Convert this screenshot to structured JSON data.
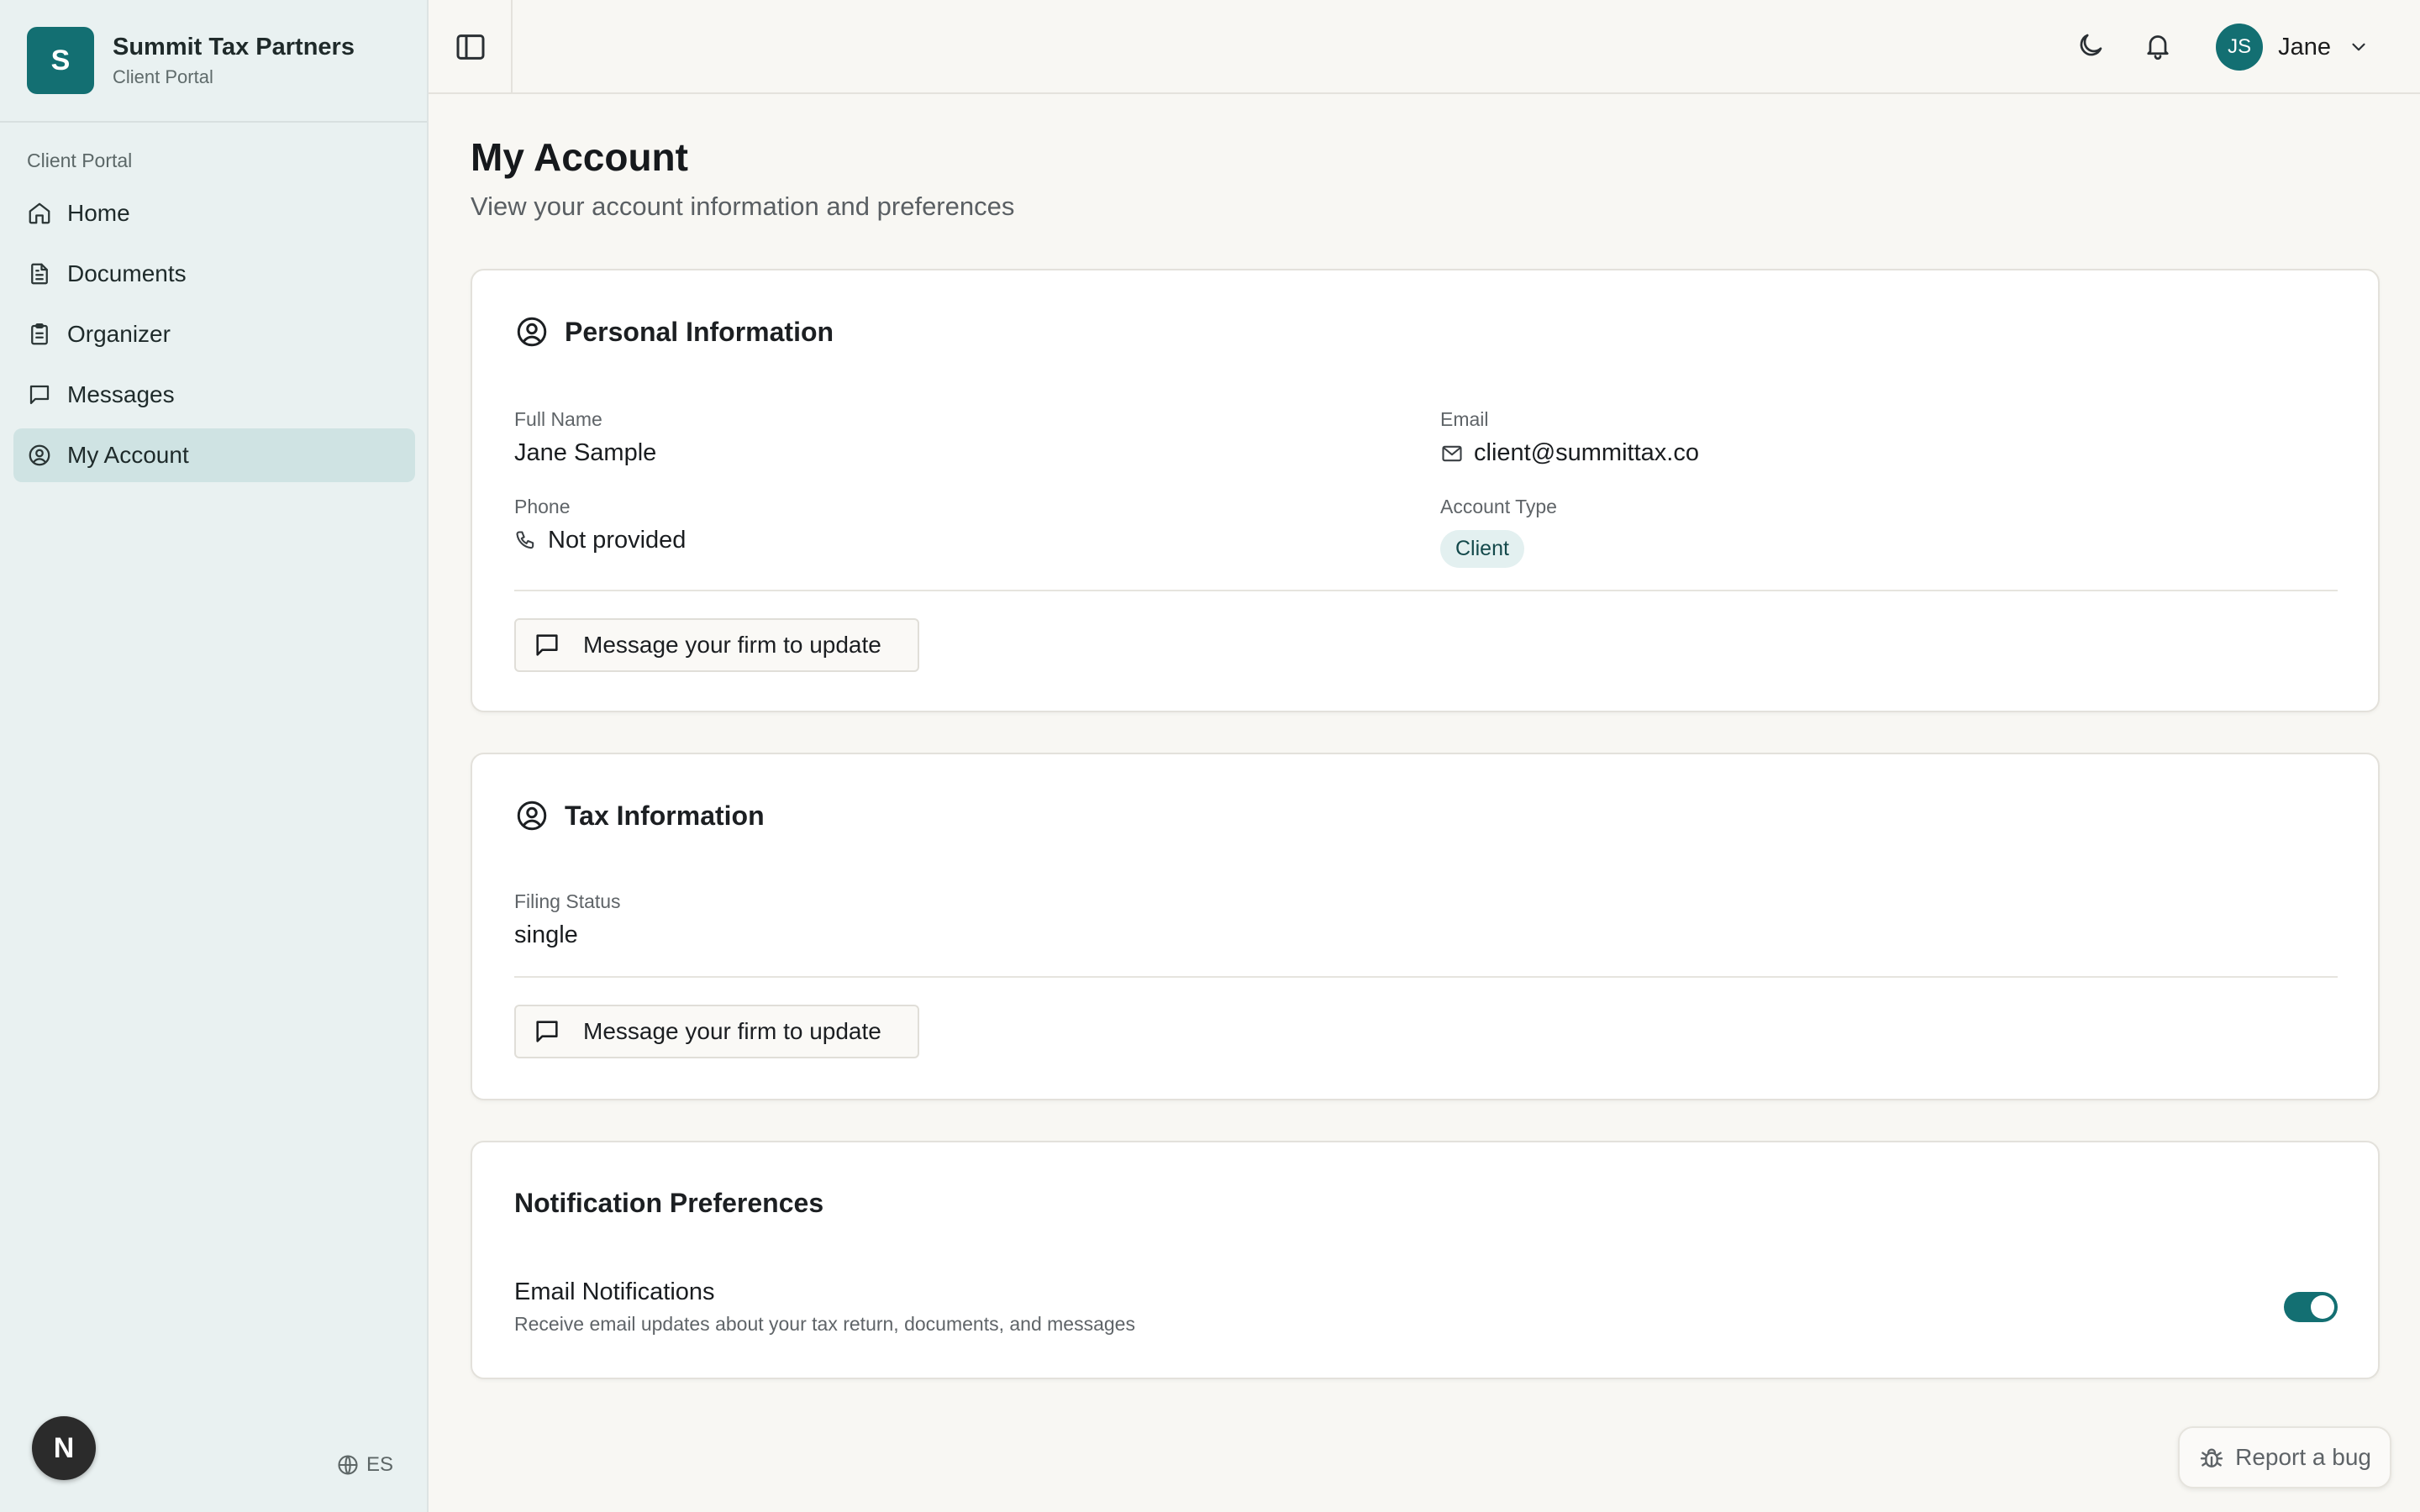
{
  "brand": {
    "logo_letter": "S",
    "name": "Summit Tax Partners",
    "subtitle": "Client Portal"
  },
  "sidebar": {
    "section_label": "Client Portal",
    "items": [
      {
        "label": "Home",
        "icon": "home-icon"
      },
      {
        "label": "Documents",
        "icon": "document-icon"
      },
      {
        "label": "Organizer",
        "icon": "clipboard-icon"
      },
      {
        "label": "Messages",
        "icon": "message-icon"
      },
      {
        "label": "My Account",
        "icon": "user-circle-icon",
        "active": true
      }
    ],
    "badge_letter": "N",
    "language": "ES"
  },
  "topbar": {
    "user": {
      "initials": "JS",
      "name": "Jane"
    }
  },
  "page": {
    "title": "My Account",
    "subtitle": "View your account information and preferences"
  },
  "personal": {
    "title": "Personal Information",
    "full_name_label": "Full Name",
    "full_name": "Jane Sample",
    "email_label": "Email",
    "email": "client@summittax.co",
    "phone_label": "Phone",
    "phone": "Not provided",
    "account_type_label": "Account Type",
    "account_type": "Client",
    "button_label": "Message your firm to update"
  },
  "tax": {
    "title": "Tax Information",
    "filing_status_label": "Filing Status",
    "filing_status": "single",
    "button_label": "Message your firm to update"
  },
  "notifications": {
    "title": "Notification Preferences",
    "email_label": "Email Notifications",
    "email_desc": "Receive email updates about your tax return, documents, and messages",
    "email_enabled": true
  },
  "report_bug_label": "Report a bug",
  "colors": {
    "accent": "#136f72",
    "sidebar_bg": "#e9f1f1",
    "active_item": "#cfe3e3",
    "page_bg": "#f8f7f3"
  }
}
